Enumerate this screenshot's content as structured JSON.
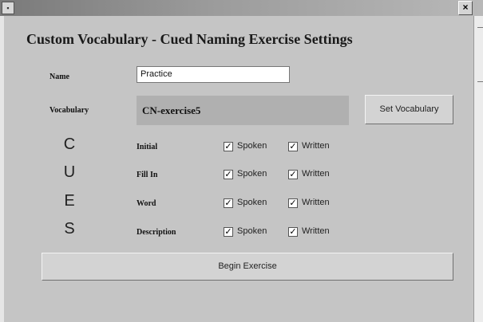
{
  "window": {
    "title": "Custom Vocabulary - Cued Naming Exercise Settings",
    "close_glyph": "×"
  },
  "form": {
    "name_label": "Name",
    "name_value": "Practice",
    "vocabulary_label": "Vocabulary",
    "vocabulary_value": "CN-exercise5",
    "set_vocabulary_button": "Set Vocabulary",
    "begin_button": "Begin Exercise"
  },
  "cues": {
    "letters": [
      "C",
      "U",
      "E",
      "S"
    ],
    "rows": [
      {
        "label": "Initial",
        "spoken_label": "Spoken",
        "spoken_checked": true,
        "written_label": "Written",
        "written_checked": true
      },
      {
        "label": "Fill In",
        "spoken_label": "Spoken",
        "spoken_checked": true,
        "written_label": "Written",
        "written_checked": true
      },
      {
        "label": "Word",
        "spoken_label": "Spoken",
        "spoken_checked": true,
        "written_label": "Written",
        "written_checked": true
      },
      {
        "label": "Description",
        "spoken_label": "Spoken",
        "spoken_checked": true,
        "written_label": "Written",
        "written_checked": true
      }
    ]
  },
  "check_glyph": "✓"
}
